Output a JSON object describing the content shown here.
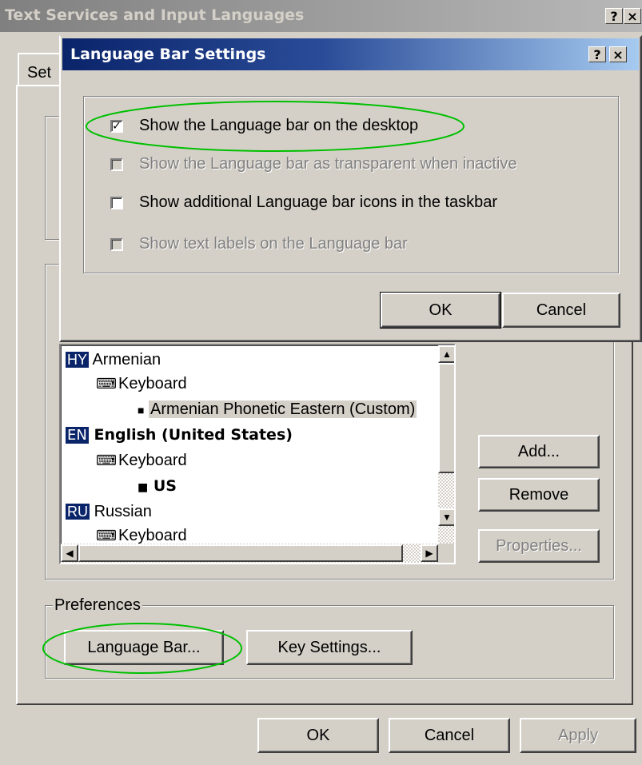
{
  "main_window": {
    "title": "Text Services and Input Languages",
    "tab_label": "Set",
    "help_btn": "?",
    "close_btn": "×",
    "installed": {
      "languages": [
        {
          "code": "HY",
          "name": "Armenian",
          "input": "Keyboard",
          "layout": "Armenian Phonetic Eastern (Custom)",
          "bold": false
        },
        {
          "code": "EN",
          "name": "English (United States)",
          "input": "Keyboard",
          "layout": "US",
          "bold": true
        },
        {
          "code": "RU",
          "name": "Russian",
          "input": "Keyboard",
          "layout": "",
          "bold": false
        }
      ],
      "add_label": "Add...",
      "remove_label": "Remove",
      "properties_label": "Properties..."
    },
    "preferences": {
      "group_label": "Preferences",
      "language_bar_label": "Language Bar...",
      "key_settings_label": "Key Settings..."
    },
    "buttons": {
      "ok": "OK",
      "cancel": "Cancel",
      "apply": "Apply"
    }
  },
  "dialog": {
    "title": "Language Bar Settings",
    "help_btn": "?",
    "close_btn": "×",
    "options": [
      {
        "label": "Show the Language bar on the desktop",
        "checked": true,
        "enabled": true
      },
      {
        "label": "Show the Language bar as transparent when inactive",
        "checked": false,
        "enabled": false
      },
      {
        "label": "Show additional Language bar icons in the taskbar",
        "checked": false,
        "enabled": true
      },
      {
        "label": "Show text labels on the Language bar",
        "checked": false,
        "enabled": false
      }
    ],
    "ok_label": "OK",
    "cancel_label": "Cancel"
  },
  "colors": {
    "highlight": "#00c000",
    "titlebar_active": "#0a246a",
    "face": "#d4d0c8"
  }
}
